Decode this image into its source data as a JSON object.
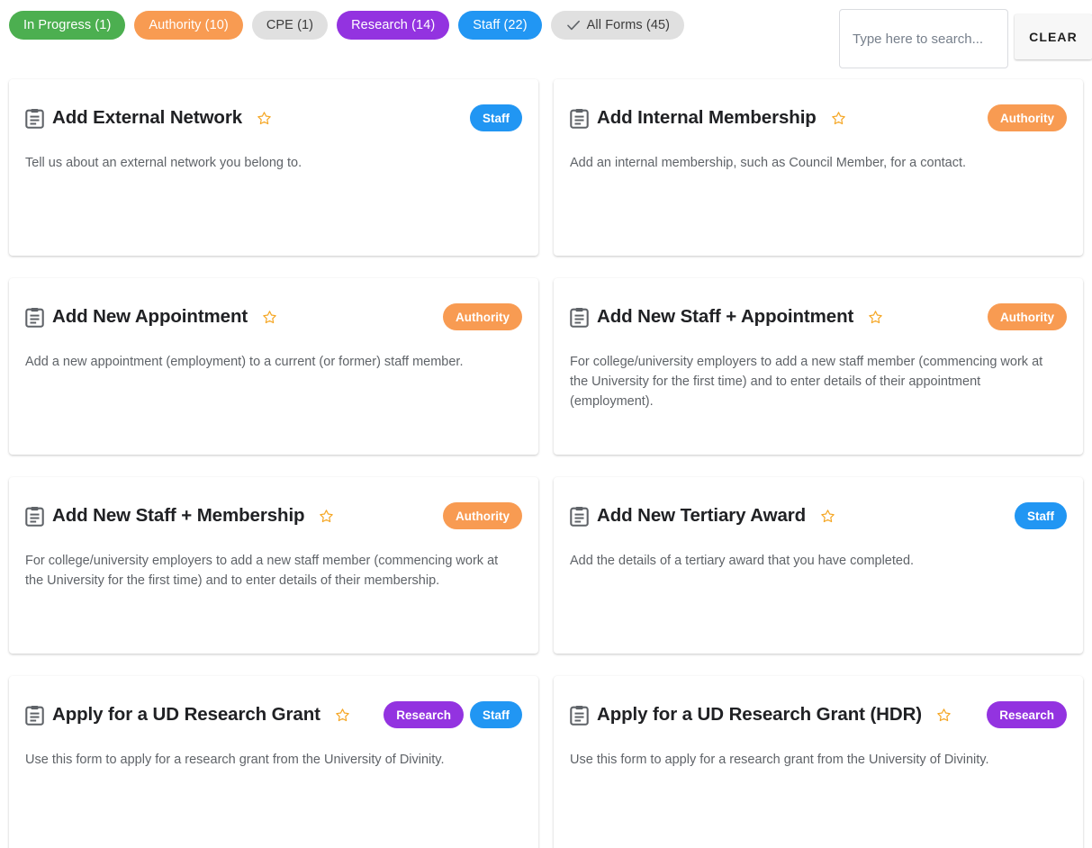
{
  "filters": [
    {
      "label": "In Progress (1)",
      "color": "green",
      "selected": false,
      "check": false
    },
    {
      "label": "Authority (10)",
      "color": "orange",
      "selected": false,
      "check": false
    },
    {
      "label": "CPE (1)",
      "color": "grey",
      "selected": false,
      "check": false
    },
    {
      "label": "Research (14)",
      "color": "purple",
      "selected": false,
      "check": false
    },
    {
      "label": "Staff (22)",
      "color": "blue",
      "selected": false,
      "check": false
    },
    {
      "label": "All Forms (45)",
      "color": "grey",
      "selected": true,
      "check": true
    }
  ],
  "search": {
    "value": "",
    "placeholder": "Type here to search...",
    "clear_label": "CLEAR"
  },
  "palette": {
    "green": "#4caf50",
    "orange": "#f89b52",
    "purple": "#9333e0",
    "blue": "#2196f3",
    "grey": "#e0e0e0",
    "star": "#f5a623",
    "title": "#202124",
    "body": "#5f6368"
  },
  "cards": [
    {
      "title": "Add External Network",
      "description": "Tell us about an external network you belong to.",
      "badges": [
        {
          "label": "Staff",
          "color": "blue"
        }
      ],
      "starred": false
    },
    {
      "title": "Add Internal Membership",
      "description": "Add an internal membership, such as Council Member, for a contact.",
      "badges": [
        {
          "label": "Authority",
          "color": "orange"
        }
      ],
      "starred": false
    },
    {
      "title": "Add New Appointment",
      "description": "Add a new appointment (employment) to a current (or former) staff member.",
      "badges": [
        {
          "label": "Authority",
          "color": "orange"
        }
      ],
      "starred": false
    },
    {
      "title": "Add New Staff + Appointment",
      "description": "For college/university employers to add a new staff member (commencing work at the University for the first time) and to enter details of their appointment (employment).",
      "badges": [
        {
          "label": "Authority",
          "color": "orange"
        }
      ],
      "starred": false
    },
    {
      "title": "Add New Staff + Membership",
      "description": "For college/university employers to add a new staff member (commencing work at the University for the first time) and to enter details of their membership.",
      "badges": [
        {
          "label": "Authority",
          "color": "orange"
        }
      ],
      "starred": false
    },
    {
      "title": "Add New Tertiary Award",
      "description": "Add the details of a tertiary award that you have completed.",
      "badges": [
        {
          "label": "Staff",
          "color": "blue"
        }
      ],
      "starred": false
    },
    {
      "title": "Apply for a UD Research Grant",
      "description": "Use this form to apply for a research grant from the University of Divinity.",
      "badges": [
        {
          "label": "Research",
          "color": "purple"
        },
        {
          "label": "Staff",
          "color": "blue"
        }
      ],
      "starred": false
    },
    {
      "title": "Apply for a UD Research Grant (HDR)",
      "description": "Use this form to apply for a research grant from the University of Divinity.",
      "badges": [
        {
          "label": "Research",
          "color": "purple"
        }
      ],
      "starred": false
    }
  ],
  "icons": {
    "clipboard": "clipboard-icon",
    "star": "star-outline-icon",
    "check": "check-icon"
  }
}
